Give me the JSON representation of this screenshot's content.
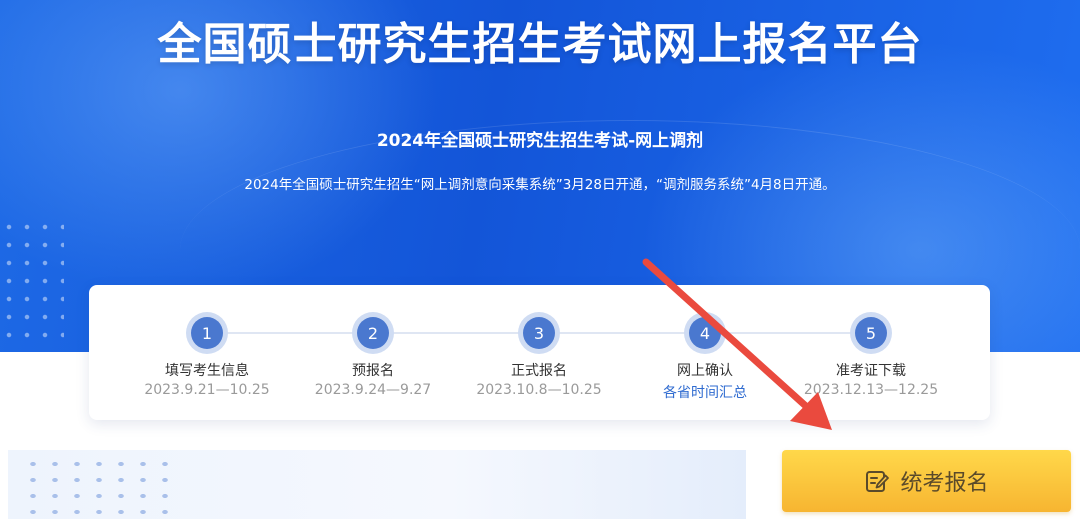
{
  "header": {
    "title": "全国硕士研究生招生考试网上报名平台",
    "subtitle": "2024年全国硕士研究生招生考试-网上调剂",
    "notice": "2024年全国硕士研究生招生“网上调剂意向采集系统”3月28日开通，“调剂服务系统”4月8日开通。"
  },
  "steps": [
    {
      "number": "1",
      "name": "填写考生信息",
      "date": "2023.9.21—10.25"
    },
    {
      "number": "2",
      "name": "预报名",
      "date": "2023.9.24—9.27"
    },
    {
      "number": "3",
      "name": "正式报名",
      "date": "2023.10.8—10.25"
    },
    {
      "number": "4",
      "name": "网上确认",
      "date": "各省时间汇总"
    },
    {
      "number": "5",
      "name": "准考证下载",
      "date": "2023.12.13—12.25"
    }
  ],
  "enroll_button": {
    "label": "统考报名",
    "icon": "edit-icon"
  },
  "colors": {
    "hero": "#1559dc",
    "step_circle": "#4a78cf",
    "link": "#2f6bd0",
    "button": "#f7b531",
    "arrow": "#ea4a3e"
  }
}
